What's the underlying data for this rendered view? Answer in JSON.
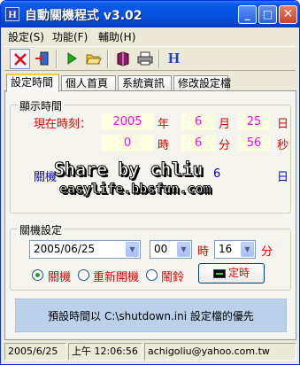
{
  "window": {
    "icon_letter": "H",
    "title": "自動關機程式 v3.02",
    "minimize": "_",
    "maximize": "□",
    "close": "✕"
  },
  "menu": [
    "設定(S)",
    "功能(F)",
    "輔助(H)"
  ],
  "toolbar": {
    "icons": [
      "close-x-icon",
      "exit-door-icon",
      "run-arrow-icon",
      "open-folder-icon",
      "book-icon",
      "printer-icon",
      "help-h-icon"
    ],
    "help_letter": "H"
  },
  "tabs": [
    "設定時間",
    "個人首頁",
    "系統資訊",
    "修改設定檔"
  ],
  "display_time": {
    "group_title": "顯示時間",
    "current_label": "現在時刻：",
    "date": {
      "year": "2005",
      "year_unit": "年",
      "month": "6",
      "month_unit": "月",
      "day": "25",
      "day_unit": "日"
    },
    "time": {
      "hour": "0",
      "hour_unit": "時",
      "minute": "6",
      "minute_unit": "分",
      "second": "56",
      "second_unit": "秒"
    },
    "shutdown_label": "關機",
    "shutdown_day_unit": "日",
    "shutdown_digit": "6"
  },
  "watermark": {
    "line1": "Share by chliu",
    "line2": "easylife.bbsfun.com"
  },
  "shutdown_settings": {
    "group_title": "關機設定",
    "date_value": "2005/06/25",
    "hour_value": "00",
    "hour_unit": "時",
    "minute_value": "16",
    "minute_unit": "分",
    "options": [
      "關機",
      "重新開機",
      "鬧鈴"
    ],
    "selected": "關機",
    "timer_button": "定時"
  },
  "info_text": "預設時間以 C:\\shutdown.ini 設定檔的優先",
  "status": {
    "date": "2005/6/25",
    "time": "上午 12:06:56",
    "email": "achigoliu@yahoo.com.tw"
  },
  "colors": {
    "title_bar": "#0553e0",
    "label_red": "#e00000",
    "value_magenta": "#ff00ff",
    "value_bg": "#ffffe1",
    "info_bg": "#b9d1ea"
  }
}
